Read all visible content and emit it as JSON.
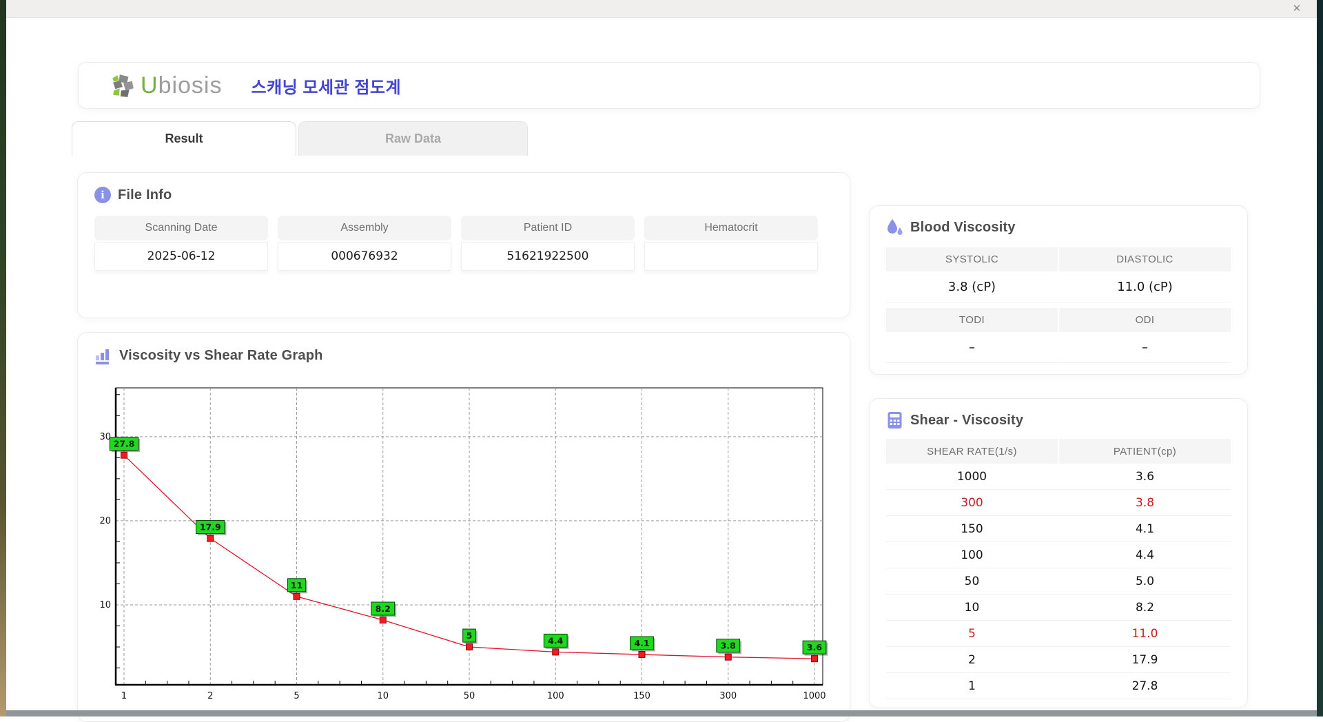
{
  "window": {
    "close_label": "✕"
  },
  "header": {
    "logo_u": "U",
    "logo_rest": "biosis",
    "app_title": "스캐닝 모세관 점도계",
    "title_color": "#4343d6"
  },
  "tabs": [
    {
      "label": "Result",
      "active": true
    },
    {
      "label": "Raw Data",
      "active": false
    }
  ],
  "file_info": {
    "title": "File Info",
    "fields": [
      {
        "label": "Scanning Date",
        "value": "2025-06-12"
      },
      {
        "label": "Assembly",
        "value": "000676932"
      },
      {
        "label": "Patient ID",
        "value": "51621922500"
      },
      {
        "label": "Hematocrit",
        "value": ""
      }
    ]
  },
  "blood_viscosity": {
    "title": "Blood Viscosity",
    "cells": [
      {
        "label": "SYSTOLIC",
        "value": "3.8 (cP)"
      },
      {
        "label": "DIASTOLIC",
        "value": "11.0 (cP)"
      },
      {
        "label": "TODI",
        "value": "–"
      },
      {
        "label": "ODI",
        "value": "–"
      }
    ]
  },
  "graph_section": {
    "title": "Viscosity vs Shear Rate Graph"
  },
  "chart_data": {
    "type": "line",
    "title": "",
    "xlabel": "",
    "ylabel": "",
    "x_axis_type": "category",
    "x": [
      1,
      2,
      5,
      10,
      50,
      100,
      150,
      300,
      1000
    ],
    "x_tick_labels": [
      "1",
      "2",
      "5",
      "10",
      "50",
      "100",
      "150",
      "300",
      "1000"
    ],
    "series": [
      {
        "name": "PATIENT",
        "values": [
          27.8,
          17.9,
          11.0,
          8.2,
          5.0,
          4.4,
          4.1,
          3.8,
          3.6
        ]
      }
    ],
    "point_labels": [
      "27.8",
      "17.9",
      "11",
      "8.2",
      "5",
      "4.4",
      "4.1",
      "3.8",
      "3.6"
    ],
    "y_ticks": [
      10,
      20,
      30
    ],
    "ylim": [
      0.5,
      35.8
    ],
    "grid": "dashed",
    "legend": "none",
    "line_color": "#e8112d",
    "marker_color": "#ee1c25",
    "marker_border": "#990000",
    "label_bg": "#21d821",
    "label_border": "#004400"
  },
  "shear_table": {
    "title": "Shear - Viscosity",
    "columns": [
      "SHEAR RATE(1/s)",
      "PATIENT(cp)"
    ],
    "rows": [
      {
        "rate": "1000",
        "value": "3.6",
        "highlight": false
      },
      {
        "rate": "300",
        "value": "3.8",
        "highlight": true
      },
      {
        "rate": "150",
        "value": "4.1",
        "highlight": false
      },
      {
        "rate": "100",
        "value": "4.4",
        "highlight": false
      },
      {
        "rate": "50",
        "value": "5.0",
        "highlight": false
      },
      {
        "rate": "10",
        "value": "8.2",
        "highlight": false
      },
      {
        "rate": "5",
        "value": "11.0",
        "highlight": true
      },
      {
        "rate": "2",
        "value": "17.9",
        "highlight": false
      },
      {
        "rate": "1",
        "value": "27.8",
        "highlight": false
      }
    ]
  },
  "colors": {
    "accent_icon": "#8a91e8",
    "highlight_red": "#c81e1e",
    "logo_green": "#76b043",
    "logo_gray": "#9d9d9d"
  }
}
